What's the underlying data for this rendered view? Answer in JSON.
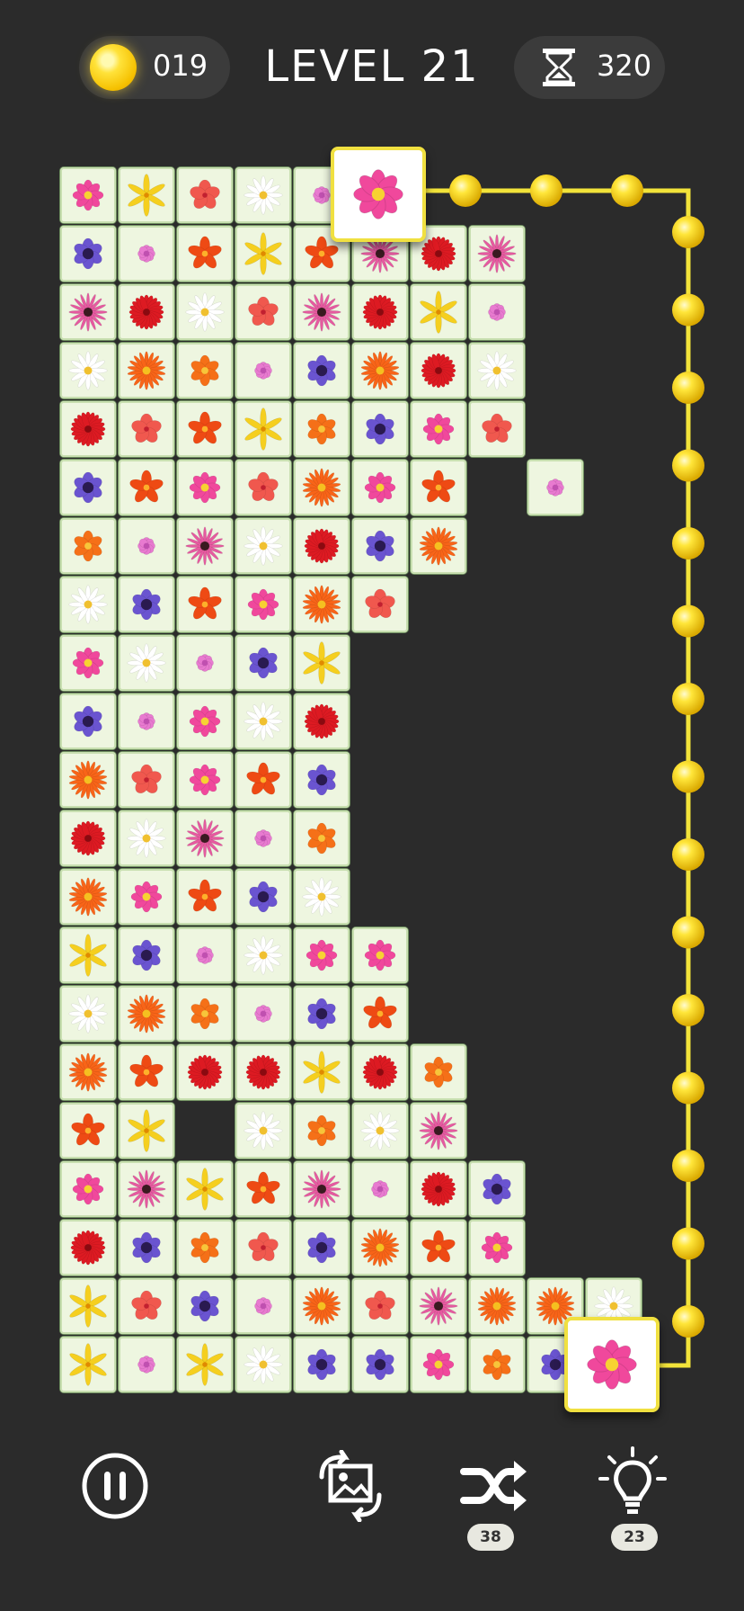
{
  "header": {
    "coins": "019",
    "level_title": "LEVEL 21",
    "timer": "320"
  },
  "toolbar": {
    "shuffle_count": "38",
    "hint_count": "23"
  },
  "colors": {
    "background": "#2b2b2b",
    "tile": "#eef6e0",
    "path": "#f2e33a",
    "selected_border": "#f0e040"
  },
  "flower_types": {
    "p": {
      "name": "pink-cosmos",
      "petal": "#f0489c",
      "center": "#f7d232"
    },
    "y": {
      "name": "yellow-lily",
      "petal": "#f5cf1f",
      "center": "#e08a00"
    },
    "h": {
      "name": "red-hibiscus",
      "petal": "#f0584e",
      "center": "#c22030"
    },
    "w": {
      "name": "white-daisy",
      "petal": "#ffffff",
      "center": "#f0c030"
    },
    "v": {
      "name": "purple-anemone",
      "petal": "#6a54d0",
      "center": "#2a1a50"
    },
    "m": {
      "name": "pink-hydrangea",
      "petal": "#e87ad0",
      "center": "#c050b0"
    },
    "t": {
      "name": "red-tulip",
      "petal": "#ee4a14",
      "center": "#fdb02a"
    },
    "c": {
      "name": "pink-coneflower",
      "petal": "#e65aa0",
      "center": "#3a1a20"
    },
    "r": {
      "name": "red-zinnia",
      "petal": "#dd1a22",
      "center": "#8a0a10"
    },
    "o": {
      "name": "orange-gerbera",
      "petal": "#f86418",
      "center": "#f5c020"
    },
    "d": {
      "name": "orange-azalea",
      "petal": "#f57018",
      "center": "#f7c53a"
    }
  },
  "grid_rows": [
    "pyhwm",
    "vmtytcrc",
    "crwhcryms",
    "wodmvorw",
    "rhtydvph",
    "vtphopt m",
    "dmcwrvo",
    "wvtpoh",
    "pwmvy",
    "vmpwr",
    "ohptv",
    "rwcmd",
    "optvw",
    "yvmwpp",
    "wodmvt",
    "otrryrd",
    "tyswdwc",
    "pcytcmrv",
    "rvdhvotp",
    "yhvmohcoow",
    "ymywvvpdv"
  ],
  "selected_flower": "p"
}
